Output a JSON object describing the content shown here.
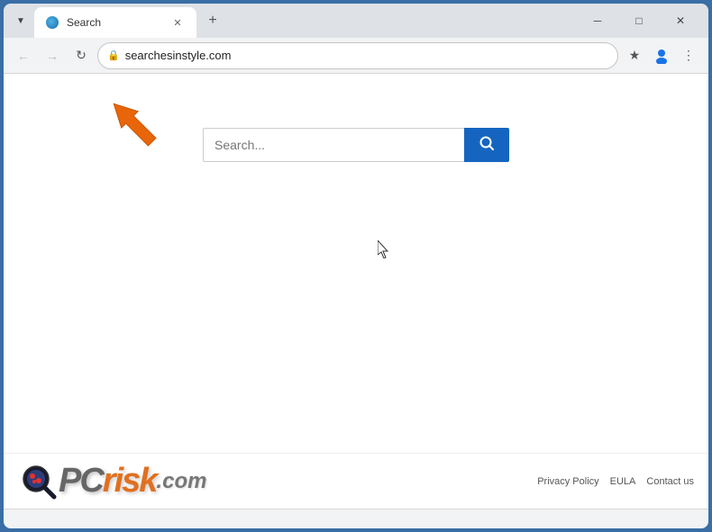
{
  "browser": {
    "tab": {
      "title": "Search",
      "favicon": "globe-icon"
    },
    "new_tab_label": "+",
    "window_controls": {
      "minimize": "─",
      "maximize": "□",
      "close": "✕"
    },
    "nav": {
      "back_disabled": true,
      "forward_disabled": true,
      "refresh_label": "↻",
      "address": "searchesinstyle.com",
      "bookmark_icon": "★",
      "profile_icon": "👤",
      "menu_icon": "⋮"
    }
  },
  "page": {
    "search_placeholder": "Search...",
    "search_btn_label": "🔍",
    "cursor": "↖"
  },
  "footer": {
    "pcrisk_pc": "PC",
    "pcrisk_risk": "risk",
    "pcrisk_dotcom": ".com",
    "links": [
      {
        "label": "Privacy Policy",
        "name": "privacy-policy-link"
      },
      {
        "label": "EULA",
        "name": "eula-link"
      },
      {
        "label": "Contact us",
        "name": "contact-link"
      }
    ]
  }
}
